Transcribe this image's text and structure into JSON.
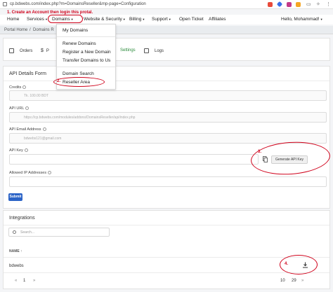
{
  "browser": {
    "url": "cp.bdwebs.com/index.php?m=DomainsReseller&mp-page=Configuration"
  },
  "annotations": {
    "step1": "1. Create an Account then login this protal.",
    "step2": "2.",
    "step3": "3.",
    "step4": "4."
  },
  "nav": {
    "home": "Home",
    "services": "Services",
    "domains": "Domains",
    "website_security": "Website & Security",
    "billing": "Billing",
    "support": "Support",
    "open_ticket": "Open Ticket",
    "affiliates": "Affiliates",
    "user": "Hello, Mohammad!"
  },
  "breadcrumb": {
    "portal_home": "Portal Home",
    "sep": "/",
    "current": "Domains R"
  },
  "dropdown": {
    "items": [
      "My Domains",
      "Renew Domains",
      "Register a New Domain",
      "Transfer Domains to Us",
      "Domain Search",
      "Reseller Area"
    ]
  },
  "tabs": {
    "orders": "Orders",
    "p": "P",
    "settings": "Settings",
    "logs": "Logs"
  },
  "api_details": {
    "title": "API Details Form",
    "credits_label": "Credits",
    "credits_value": "Tk. 100.00 BDT",
    "api_url_label": "API URL",
    "api_url_value": "https://cp.bdwebs.com/modules/addons/DomainsReseller/api/index.php",
    "api_email_label": "API Email Address",
    "api_email_value": "bdwebs121@gmail.com",
    "api_key_label": "API Key",
    "generate_label": "Generate API Key",
    "allowed_ip_label": "Allowed IP Addresses",
    "submit_label": "Submit"
  },
  "integrations": {
    "title": "Integrations",
    "search_placeholder": "Search...",
    "col_name": "NAME",
    "sort_arrow": "↑",
    "row_name": "bdwebs",
    "pager_prev": "«",
    "pager_page": "1",
    "pager_next": "»",
    "page_size_a": "10",
    "page_size_b": "29",
    "pager_caret": "»"
  },
  "colors": {
    "accent": "#2b63c7",
    "annotation": "#d0021b"
  },
  "icons": [
    "lock-icon",
    "cart-icon",
    "dollar-icon",
    "gear-icon",
    "logs-icon",
    "help-icon",
    "copy-icon",
    "search-icon",
    "download-icon"
  ]
}
